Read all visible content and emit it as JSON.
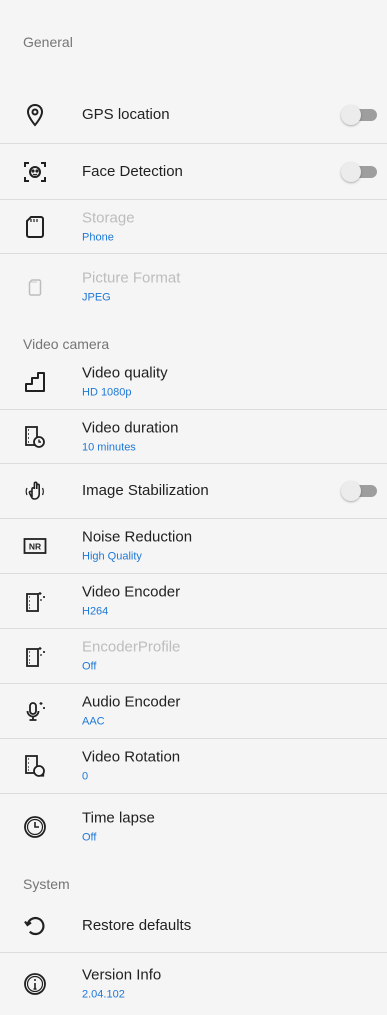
{
  "sections": {
    "general": "General",
    "video_camera": "Video camera",
    "system": "System"
  },
  "general": {
    "gps": {
      "title": "GPS location",
      "icon": "location-pin-icon",
      "enabled": false
    },
    "face": {
      "title": "Face Detection",
      "icon": "face-detection-icon",
      "enabled": false
    },
    "storage": {
      "title": "Storage",
      "value": "Phone",
      "icon": "sd-card-icon"
    },
    "picture_format": {
      "title": "Picture Format",
      "value": "JPEG",
      "icon": "sd-card-small-icon"
    }
  },
  "video": {
    "quality": {
      "title": "Video quality",
      "value": "HD 1080p",
      "icon": "stairs-icon"
    },
    "duration": {
      "title": "Video duration",
      "value": "10 minutes",
      "icon": "film-clock-icon"
    },
    "stabilization": {
      "title": "Image Stabilization",
      "icon": "hand-vibrate-icon",
      "enabled": false
    },
    "noise": {
      "title": "Noise Reduction",
      "value": "High Quality",
      "icon": "nr-icon"
    },
    "encoder": {
      "title": "Video Encoder",
      "value": "H264",
      "icon": "film-sparkle-icon"
    },
    "encoder_profile": {
      "title": "EncoderProfile",
      "value": "Off",
      "icon": "film-sparkle-icon"
    },
    "audio_encoder": {
      "title": "Audio Encoder",
      "value": "AAC",
      "icon": "microphone-sparkle-icon"
    },
    "rotation": {
      "title": "Video Rotation",
      "value": "0",
      "icon": "film-rotate-icon"
    },
    "timelapse": {
      "title": "Time lapse",
      "value": "Off",
      "icon": "clock-icon"
    }
  },
  "system": {
    "restore": {
      "title": "Restore defaults",
      "icon": "restore-icon"
    },
    "version": {
      "title": "Version Info",
      "value": "2.04.102",
      "icon": "info-icon"
    }
  },
  "colors": {
    "accent": "#1e78d7",
    "background": "#f5f5f5",
    "divider": "#dcdcdc",
    "section": "#757575"
  }
}
